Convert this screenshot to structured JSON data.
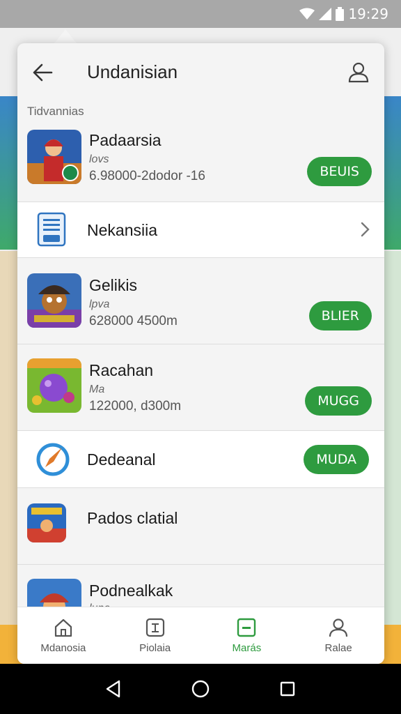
{
  "status_bar": {
    "time": "19:29",
    "icons": [
      "wifi-icon",
      "signal-icon",
      "battery-icon"
    ]
  },
  "header": {
    "title": "Undanisian",
    "back_icon": "arrow-left-icon",
    "profile_icon": "person-icon"
  },
  "section_label": "Tidvannias",
  "rows": [
    {
      "type": "app",
      "name": "Padaarsia",
      "sub": "lovs",
      "meta": "6.98000-2dodor -16",
      "button": "BEUIS",
      "icon": "warrior-game-icon"
    },
    {
      "type": "link",
      "label": "Nekansiia",
      "icon": "document-icon",
      "trailing_icon": "chevron-right-icon"
    },
    {
      "type": "app",
      "name": "Gelikis",
      "sub": "lpva",
      "meta": "628000  4500m",
      "button": "BLIER",
      "icon": "pirate-game-icon"
    },
    {
      "type": "app",
      "name": "Racahan",
      "sub": "Ma",
      "meta": "122000, d300m",
      "button": "MUGG",
      "icon": "puzzle-game-icon"
    },
    {
      "type": "action",
      "label": "Dedeanal",
      "button": "MUDA",
      "icon": "compass-icon"
    },
    {
      "type": "plain",
      "label": "Pados clatial",
      "icon": "arcade-game-icon"
    },
    {
      "type": "app-partial",
      "name": "Podnealkak",
      "sub": "luna",
      "icon": "hero-game-icon"
    }
  ],
  "bottom_nav": [
    {
      "label": "Mdanosia",
      "icon": "home-icon",
      "active": false
    },
    {
      "label": "Piolaia",
      "icon": "calculator-icon",
      "active": false
    },
    {
      "label": "Marás",
      "icon": "minus-box-icon",
      "active": true
    },
    {
      "label": "Ralae",
      "icon": "person-icon",
      "active": false
    }
  ],
  "system_nav": [
    "back-triangle-icon",
    "home-circle-icon",
    "recents-square-icon"
  ],
  "colors": {
    "accent": "#2e9b3f",
    "panel": "#f4f4f4",
    "status_bar": "#a8a8a8"
  }
}
